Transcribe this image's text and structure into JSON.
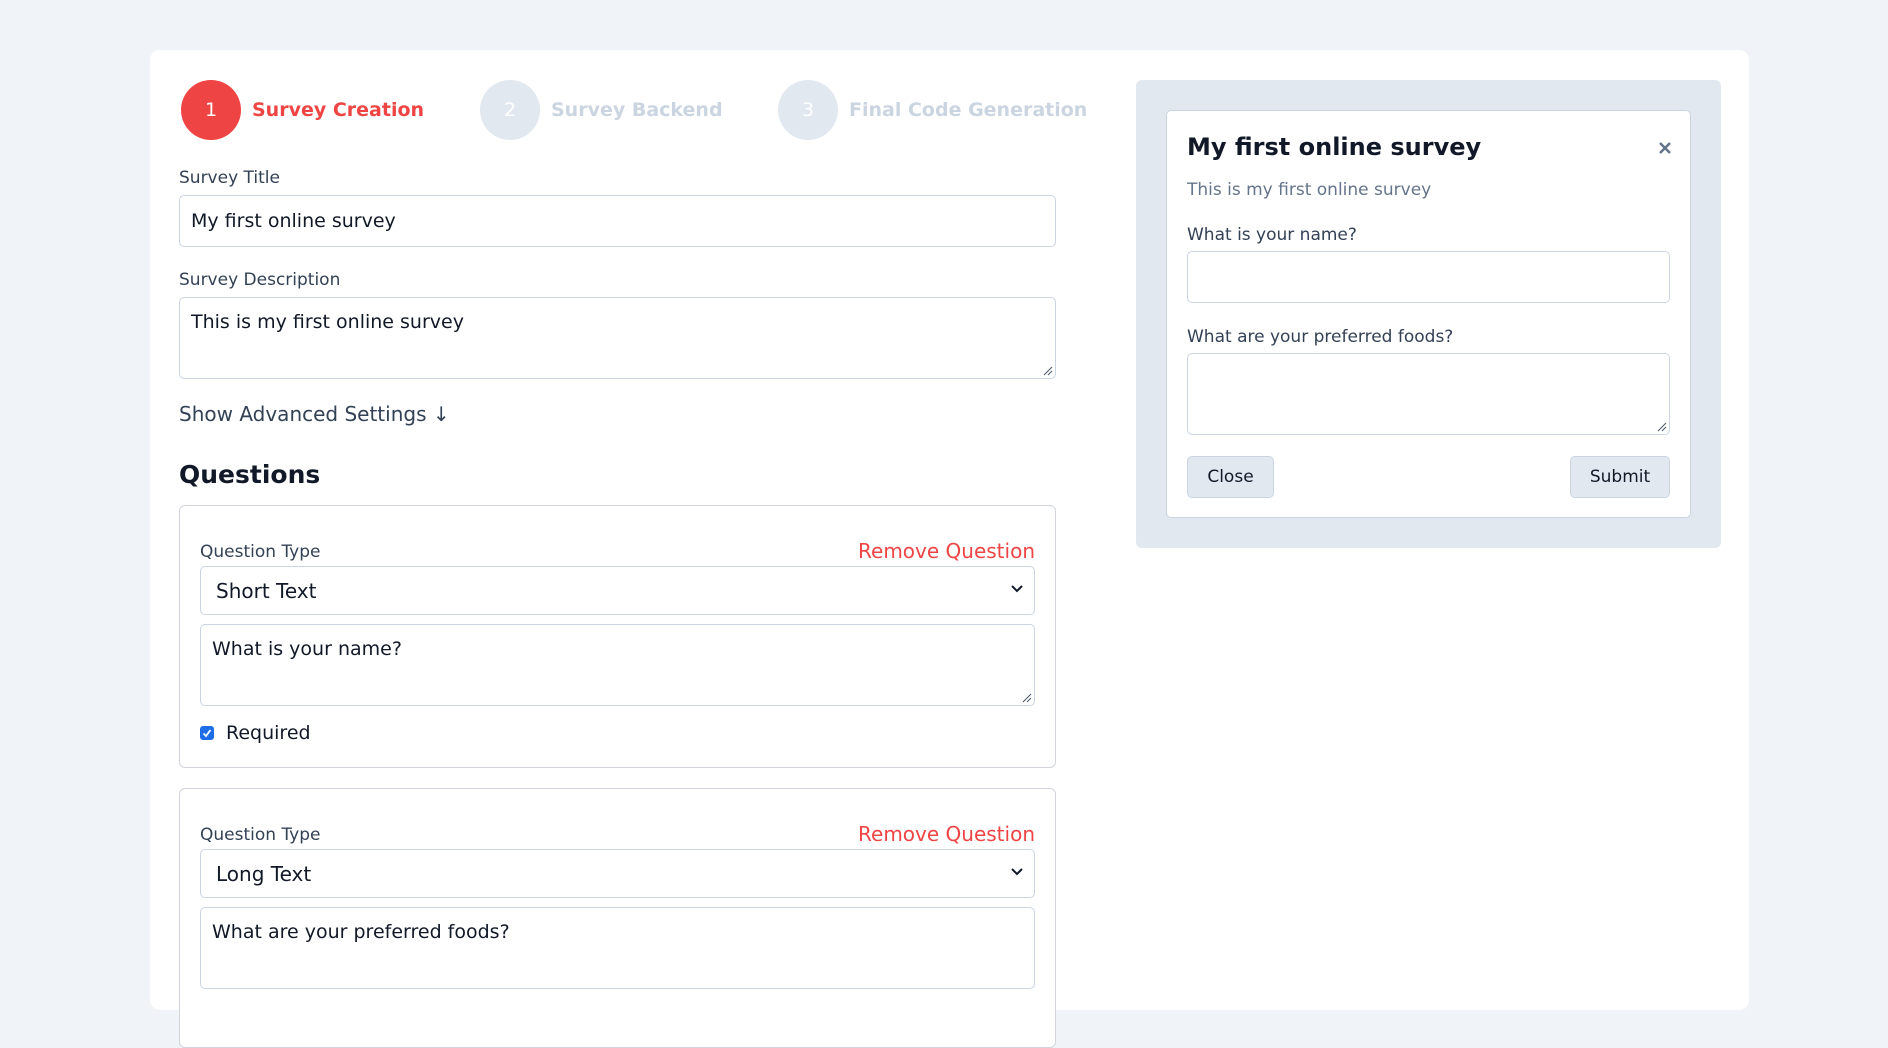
{
  "stepper": [
    {
      "number": "1",
      "label": "Survey Creation",
      "state": "active"
    },
    {
      "number": "2",
      "label": "Survey Backend",
      "state": "inactive"
    },
    {
      "number": "3",
      "label": "Final Code Generation",
      "state": "inactive"
    }
  ],
  "form": {
    "title_label": "Survey Title",
    "title_value": "My first online survey",
    "description_label": "Survey Description",
    "description_value": "This is my first online survey",
    "advanced_link": "Show Advanced Settings ↓"
  },
  "questions_heading": "Questions",
  "questions": [
    {
      "type_label": "Question Type",
      "remove_label": "Remove Question",
      "type_value": "Short Text",
      "text": "What is your name?",
      "required_label": "Required",
      "required": true
    },
    {
      "type_label": "Question Type",
      "remove_label": "Remove Question",
      "type_value": "Long Text",
      "text": "What are your preferred foods?"
    }
  ],
  "preview": {
    "title": "My first online survey",
    "description": "This is my first online survey",
    "question_1_label": "What is your name?",
    "question_2_label": "What are your preferred foods?",
    "close_button": "Close",
    "submit_button": "Submit"
  },
  "colors": {
    "accent": "#ef4444",
    "inactive_step": "#e2e8f0",
    "checkbox": "#1d6ee6",
    "page_bg": "#f0f3f8"
  },
  "icons": [
    "chevron-down-icon",
    "close-icon",
    "resize-handle-icon",
    "checkmark-icon"
  ]
}
